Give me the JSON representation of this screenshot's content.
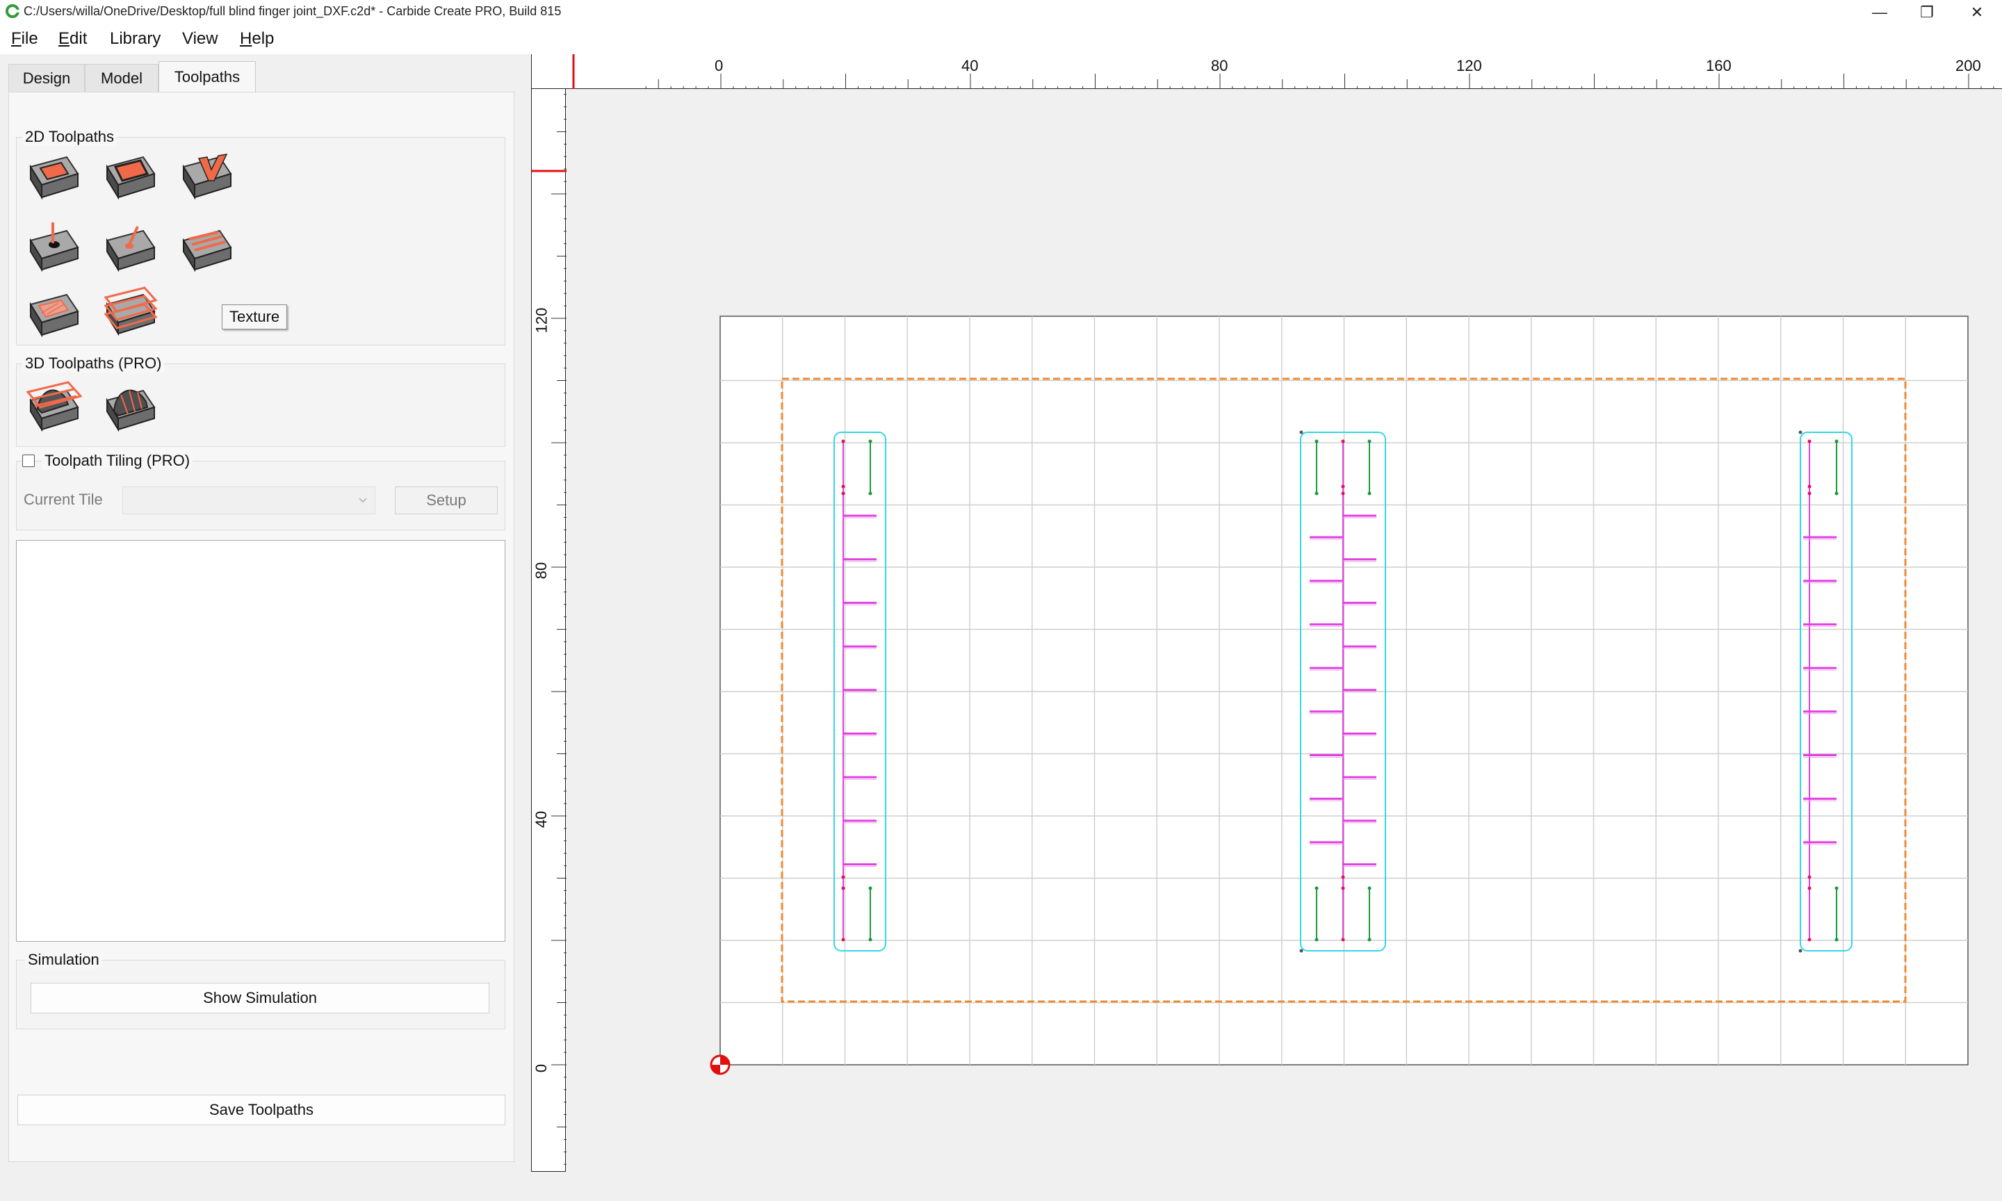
{
  "window": {
    "title": "C:/Users/willa/OneDrive/Desktop/full blind finger joint_DXF.c2d* - Carbide Create PRO, Build 815",
    "minimize_glyph": "—",
    "restore_glyph": "❐",
    "close_glyph": "✕"
  },
  "menu": [
    {
      "key": "F",
      "rest": "ile"
    },
    {
      "key": "E",
      "rest": "dit"
    },
    {
      "key": "",
      "rest": "Library"
    },
    {
      "key": "",
      "rest": "View"
    },
    {
      "key": "H",
      "rest": "elp"
    }
  ],
  "tabs": [
    "Design",
    "Model",
    "Toolpaths"
  ],
  "active_tab": "Toolpaths",
  "toolpaths_2d": {
    "title": "2D Toolpaths",
    "tooltip": "Texture"
  },
  "toolpaths_3d": {
    "title": "3D Toolpaths (PRO)"
  },
  "tiling": {
    "label": "Toolpath Tiling (PRO)",
    "checked": false,
    "current_tile_label": "Current Tile",
    "current_tile_value": "",
    "setup_label": "Setup"
  },
  "simulation": {
    "title": "Simulation",
    "show_button": "Show Simulation"
  },
  "save_button": "Save Toolpaths",
  "ruler": {
    "top_labels": [
      "0",
      "40",
      "80",
      "120",
      "160",
      "200"
    ],
    "left_labels": [
      "120",
      "80",
      "40",
      "0"
    ]
  },
  "colors": {
    "accent_orange": "#f06a4a",
    "stock_border": "#f08a30",
    "toolpath_cyan": "#33d6e8",
    "toolpath_magenta": "#e040e0",
    "toolpath_green": "#1a9a3a",
    "origin_red": "#e01010"
  }
}
